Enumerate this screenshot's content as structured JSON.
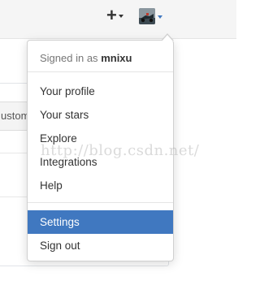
{
  "header": {
    "new_icon": "plus-icon",
    "avatar_icon": "user-avatar"
  },
  "background": {
    "tab_fragment": "ustom"
  },
  "menu": {
    "signed_in_prefix": "Signed in as",
    "username": "mnixu",
    "items": [
      {
        "label": "Your profile"
      },
      {
        "label": "Your stars"
      },
      {
        "label": "Explore"
      },
      {
        "label": "Integrations"
      },
      {
        "label": "Help"
      },
      {
        "label": "Settings"
      },
      {
        "label": "Sign out"
      }
    ],
    "active_item": "Settings",
    "accent_color": "#4078c0"
  },
  "watermark": "http://blog.csdn.net/"
}
